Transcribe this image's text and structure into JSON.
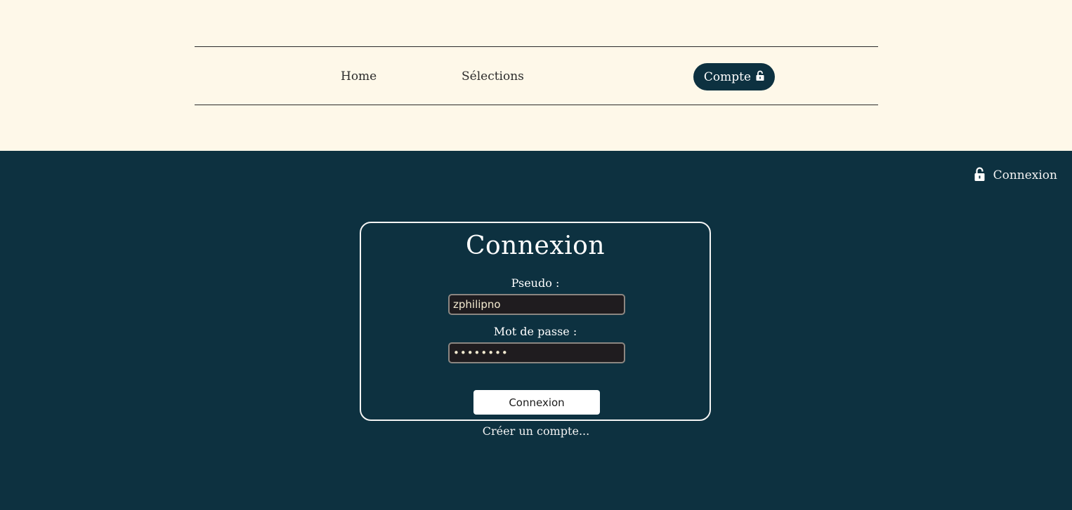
{
  "nav": {
    "home_label": "Home",
    "selections_label": "Sélections",
    "compte_label": "Compte"
  },
  "top_right": {
    "connexion_label": "Connexion"
  },
  "login": {
    "title": "Connexion",
    "pseudo_label": "Pseudo :",
    "pseudo_value": "zphilipno",
    "password_label": "Mot de passe :",
    "password_value": "••••••••",
    "submit_label": "Connexion",
    "create_account_link": "Créer un compte..."
  },
  "icons": {
    "compte_icon": "unlock-icon",
    "connexion_icon": "unlock-icon"
  },
  "colors": {
    "header_bg": "#fef8e9",
    "page_bg": "#0d3140",
    "accent": "#0d3140",
    "card_border": "#f4f4f4",
    "input_bg": "#1f1c1f"
  }
}
